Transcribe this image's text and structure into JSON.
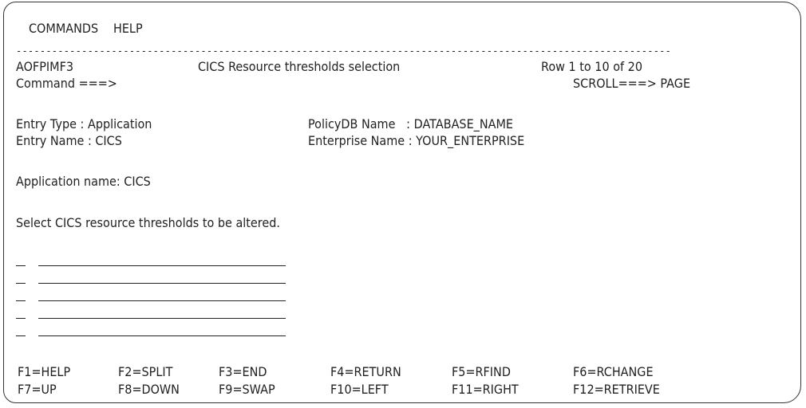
{
  "menu": {
    "commands": "COMMANDS",
    "help": "HELP"
  },
  "separator": "--------------------------------------------------------------------------------------------------------------",
  "header": {
    "panel_id": "AOFPIMF3",
    "title": "CICS Resource thresholds selection",
    "row_info": "Row 1 to 10 of 20",
    "command_label": "Command ===>",
    "scroll": "SCROLL===> PAGE"
  },
  "info": {
    "entry_type": "Entry Type : Application",
    "entry_name": "Entry Name : CICS",
    "policydb": "PolicyDB Name   : DATABASE_NAME",
    "enterprise": "Enterprise Name : YOUR_ENTERPRISE"
  },
  "application_line": "Application name: CICS",
  "instruction": "Select CICS resource thresholds to be altered.",
  "pf_keys": [
    [
      "F1=HELP",
      "F2=SPLIT",
      "F3=END",
      "F4=RETURN",
      "F5=RFIND",
      "F6=RCHANGE"
    ],
    [
      "F7=UP",
      "F8=DOWN",
      "F9=SWAP",
      "F10=LEFT",
      "F11=RIGHT",
      "F12=RETRIEVE"
    ]
  ]
}
